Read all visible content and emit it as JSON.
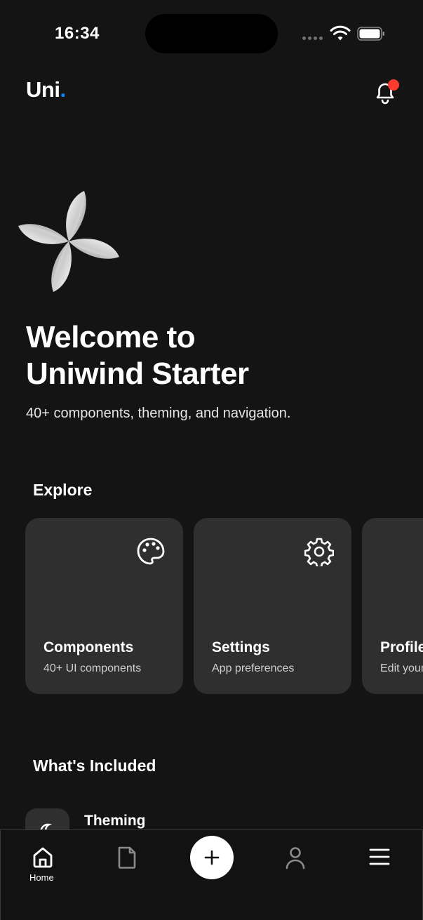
{
  "status_bar": {
    "time": "16:34"
  },
  "header": {
    "brand_name": "Uni",
    "brand_dot": ".",
    "accent_color": "#0a84ff",
    "notification_badge_color": "#ff3b30"
  },
  "hero": {
    "title_line1": "Welcome to",
    "title_line2": "Uniwind Starter",
    "subtitle": "40+ components, theming, and navigation."
  },
  "explore": {
    "section_title": "Explore",
    "cards": [
      {
        "title": "Components",
        "subtitle": "40+ UI components",
        "icon": "palette-icon"
      },
      {
        "title": "Settings",
        "subtitle": "App preferences",
        "icon": "gear-icon"
      },
      {
        "title": "Profile",
        "subtitle": "Edit your profile",
        "icon": "user-icon"
      }
    ]
  },
  "included": {
    "section_title": "What's Included",
    "items": [
      {
        "title": "Theming",
        "icon": "moon-icon"
      }
    ]
  },
  "tab_bar": {
    "tabs": [
      {
        "label": "Home",
        "icon": "home-icon",
        "active": true
      },
      {
        "label": "",
        "icon": "document-icon",
        "active": false
      },
      {
        "label": "",
        "icon": "plus-icon",
        "active": false
      },
      {
        "label": "",
        "icon": "user-icon",
        "active": false
      },
      {
        "label": "",
        "icon": "menu-icon",
        "active": false
      }
    ]
  }
}
